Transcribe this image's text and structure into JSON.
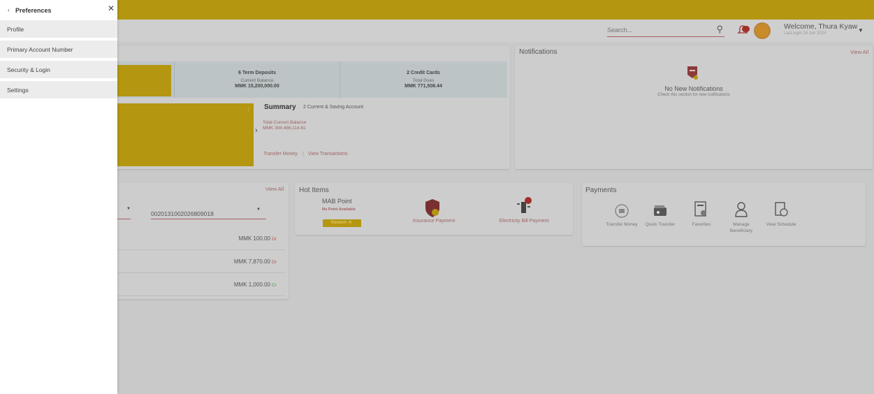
{
  "header": {
    "search_placeholder": "Search...",
    "notification_badge": "",
    "welcome": "Welcome, Thura Kyaw",
    "last_login": "Last login 24 Jun 2024",
    "accent_color": "#b49610"
  },
  "accounts": {
    "term_deposits_title": "6 Term Deposits",
    "term_deposits_sub": "Current Balance",
    "term_deposits_value": "MMK 15,200,000.00",
    "credit_cards_title": "2 Credit Cards",
    "credit_cards_sub": "Total Dues",
    "credit_cards_value": "MMK 771,506.44",
    "summary_title": "Summary",
    "summary_sub": "2 Current & Saving Account",
    "total_balance_label": "Total Current Balance",
    "total_balance_value": "MMK 394,486,114.61",
    "transfer_money": "Transfer Money",
    "view_transactions": "View Transactions"
  },
  "notifications": {
    "title": "Notifications",
    "view_all": "View All",
    "empty_title": "No New Notifications",
    "empty_sub": "Check this section for new notifications"
  },
  "transactions": {
    "view_all": "View All",
    "account_number": "0020131002026809018",
    "rows": [
      {
        "amount": "MMK 100.00",
        "type": "Dr"
      },
      {
        "amount": "MMK 7,870.00",
        "type": "Dr"
      },
      {
        "amount": "MMK 1,000.00",
        "type": "Cr"
      }
    ]
  },
  "hot_items": {
    "title": "Hot Items",
    "mab_title": "MAB Point",
    "mab_sub": "No Point Available",
    "mab_button": "Redeem",
    "insurance": "Insurance Payment",
    "electricity": "Electricity Bill Payment"
  },
  "payments": {
    "title": "Payments",
    "items": [
      {
        "label": "Transfer Money",
        "icon": "transfer-icon"
      },
      {
        "label": "Quick Transfer",
        "icon": "wallet-icon"
      },
      {
        "label": "Favorites",
        "icon": "favorites-icon"
      },
      {
        "label": "Manage Beneficiary",
        "icon": "beneficiary-icon"
      },
      {
        "label": "View Schedule",
        "icon": "schedule-icon"
      }
    ]
  },
  "drawer": {
    "title": "Preferences",
    "items": [
      {
        "label": "Profile"
      },
      {
        "label": "Primary Account Number"
      },
      {
        "label": "Security & Login"
      },
      {
        "label": "Settings"
      }
    ]
  }
}
